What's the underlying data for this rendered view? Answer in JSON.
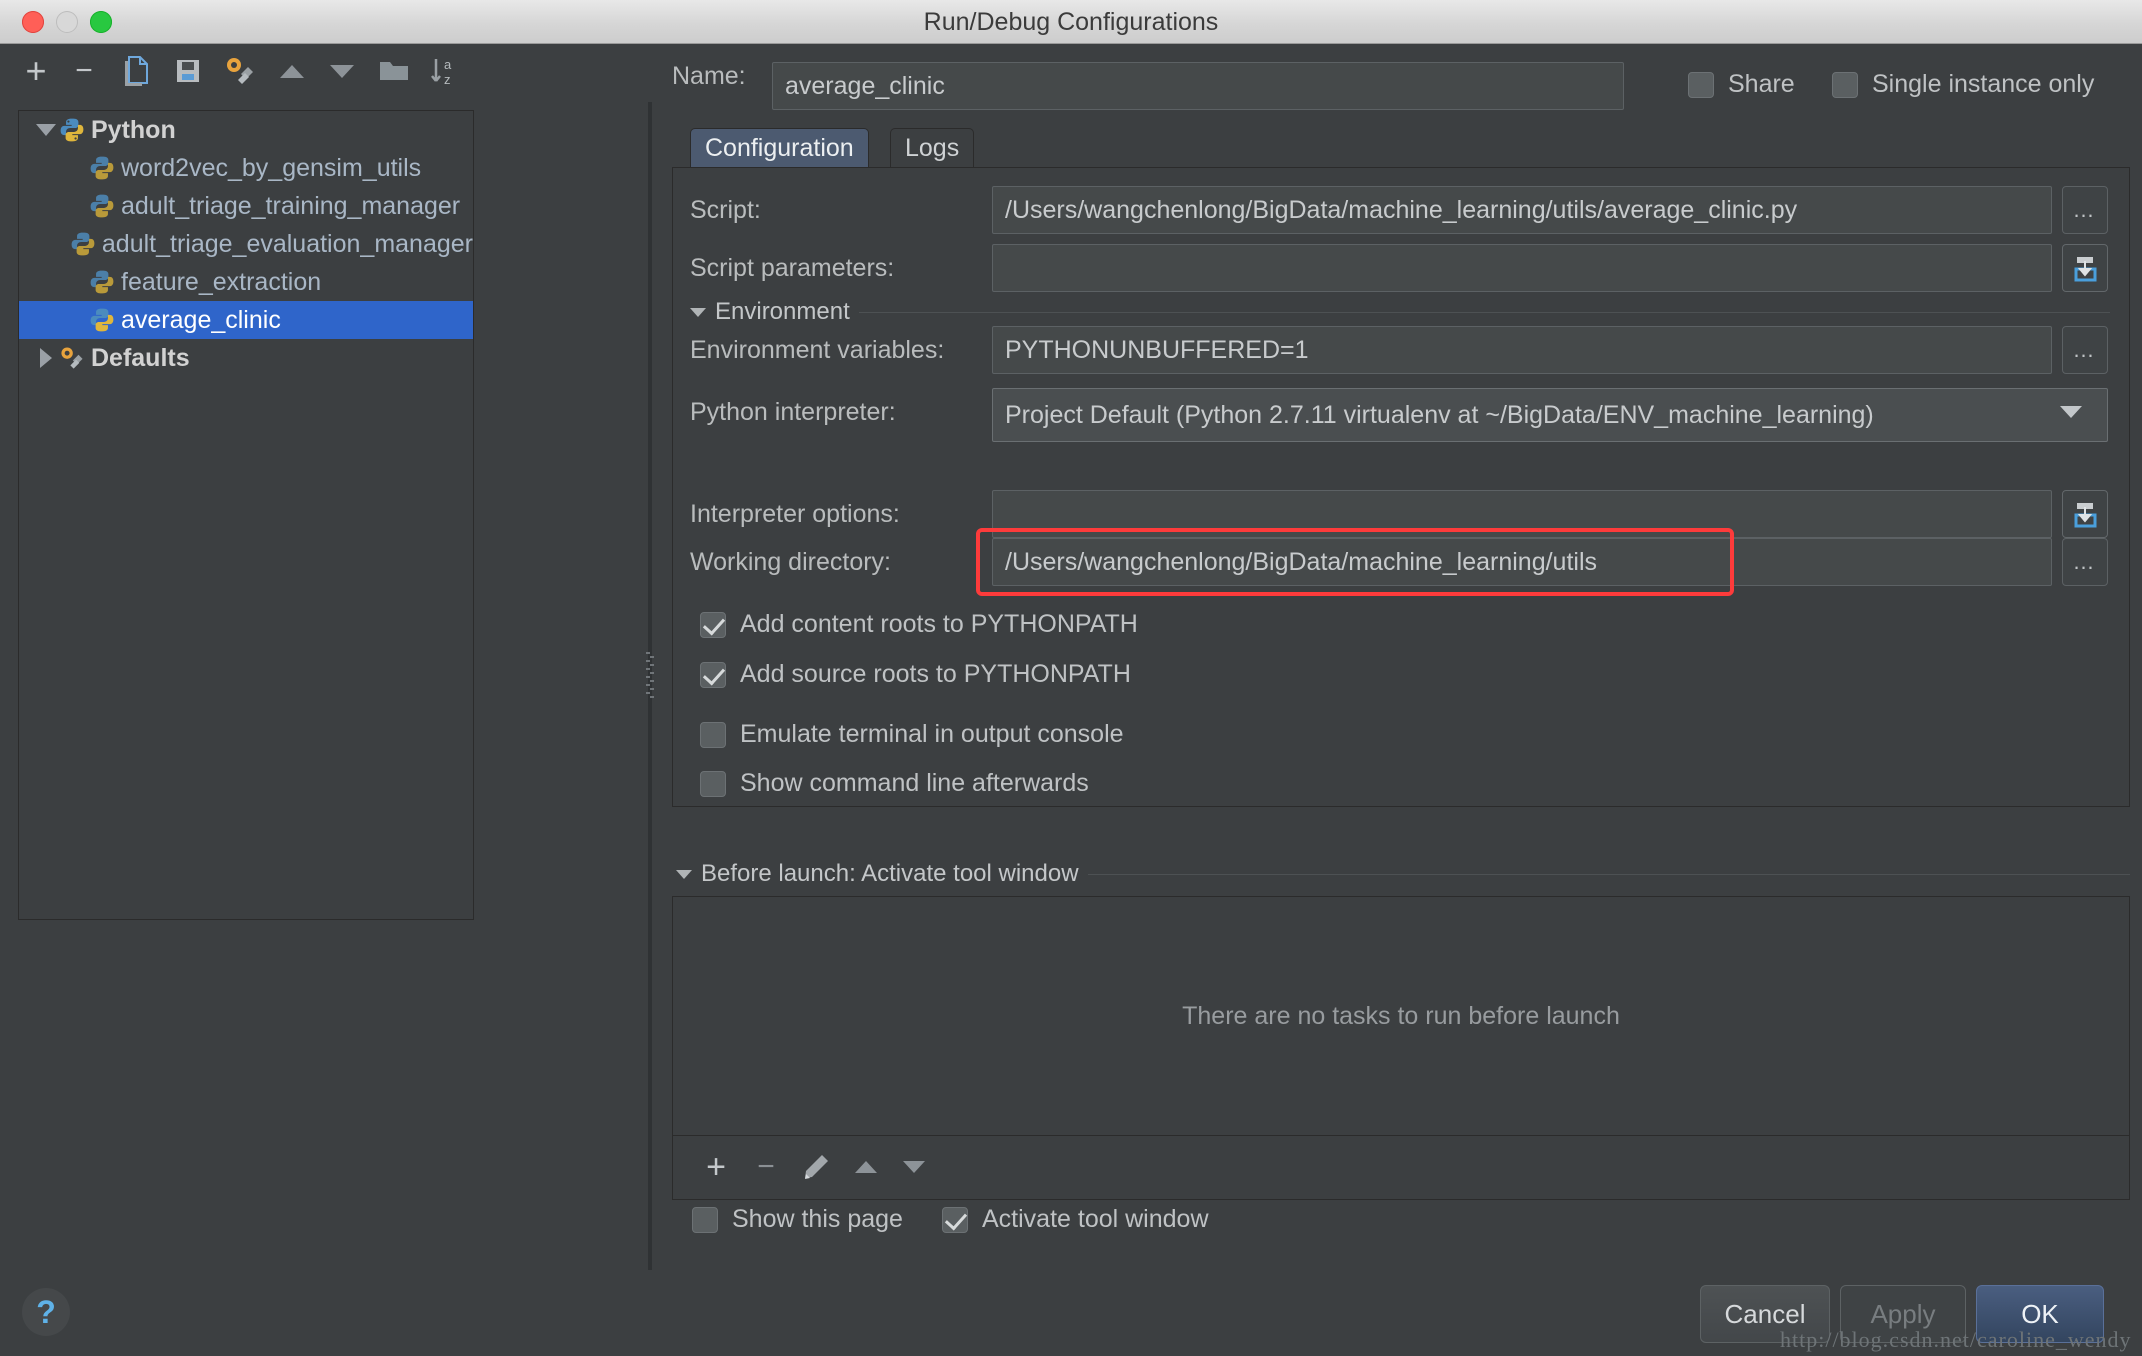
{
  "window": {
    "title": "Run/Debug Configurations"
  },
  "toolbar": {
    "add": "+",
    "remove": "−",
    "copy_icon": "copy-icon",
    "save_icon": "save-icon",
    "edit_defaults_icon": "wrench-icon",
    "move_up": "move-up-icon",
    "move_down": "move-down-icon",
    "folder_icon": "folder-icon",
    "sort_icon": "sort-alphabetically-icon"
  },
  "tree": {
    "groups": [
      {
        "label": "Python",
        "expanded": true,
        "items": [
          {
            "label": "word2vec_by_gensim_utils",
            "selected": false
          },
          {
            "label": "adult_triage_training_manager",
            "selected": false
          },
          {
            "label": "adult_triage_evaluation_manager",
            "selected": false
          },
          {
            "label": "feature_extraction",
            "selected": false
          },
          {
            "label": "average_clinic",
            "selected": true
          }
        ]
      },
      {
        "label": "Defaults",
        "expanded": false,
        "items": []
      }
    ]
  },
  "header": {
    "name_label": "Name:",
    "name_value": "average_clinic",
    "share_label": "Share",
    "share_checked": false,
    "single_instance_label": "Single instance only",
    "single_instance_checked": false
  },
  "tabs": [
    {
      "label": "Configuration",
      "active": true
    },
    {
      "label": "Logs",
      "active": false
    }
  ],
  "form": {
    "script_label": "Script:",
    "script_value": "/Users/wangchenlong/BigData/machine_learning/utils/average_clinic.py",
    "script_browse": "…",
    "script_params_label": "Script parameters:",
    "script_params_value": "",
    "script_params_expand_icon": "expand-field-icon",
    "environment_section": "Environment",
    "env_vars_label": "Environment variables:",
    "env_vars_value": "PYTHONUNBUFFERED=1",
    "env_vars_browse": "…",
    "interpreter_label": "Python interpreter:",
    "interpreter_value": "Project Default (Python 2.7.11 virtualenv at ~/BigData/ENV_machine_learning)",
    "interpreter_options_label": "Interpreter options:",
    "interpreter_options_value": "",
    "interpreter_options_expand_icon": "expand-field-icon",
    "working_dir_label": "Working directory:",
    "working_dir_value": "/Users/wangchenlong/BigData/machine_learning/utils",
    "working_dir_browse": "…",
    "checkboxes": [
      {
        "label": "Add content roots to PYTHONPATH",
        "checked": true
      },
      {
        "label": "Add source roots to PYTHONPATH",
        "checked": true
      },
      {
        "label": "Emulate terminal in output console",
        "checked": false
      },
      {
        "label": "Show command line afterwards",
        "checked": false
      }
    ]
  },
  "before_launch": {
    "section": "Before launch: Activate tool window",
    "empty_message": "There are no tasks to run before launch",
    "toolbar": {
      "add": "+",
      "remove": "−",
      "edit_icon": "pencil-icon",
      "move_up": "move-up-icon",
      "move_down": "move-down-icon"
    },
    "options": [
      {
        "label": "Show this page",
        "checked": false
      },
      {
        "label": "Activate tool window",
        "checked": true
      }
    ]
  },
  "footer": {
    "help": "?",
    "cancel": "Cancel",
    "apply": "Apply",
    "ok": "OK"
  },
  "watermark": "http://blog.csdn.net/caroline_wendy",
  "colors": {
    "window_bg": "#3c3f41",
    "selection_blue": "#2f65ca",
    "highlight_red": "#fd3b3b",
    "tab_active": "#4c5a70",
    "ok_button": "#33455f",
    "text": "#bbbbbb"
  }
}
